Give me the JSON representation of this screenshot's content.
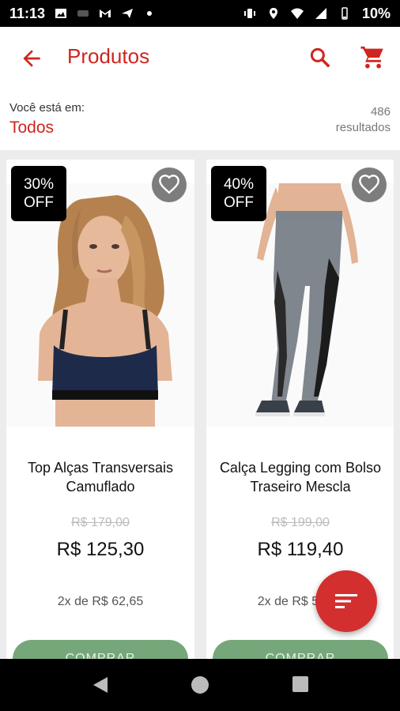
{
  "status_bar": {
    "time": "11:13",
    "battery": "10%"
  },
  "app_bar": {
    "title": "Produtos"
  },
  "location": {
    "label": "Você está em:",
    "value": "Todos",
    "results_count": "486",
    "results_label": "resultados"
  },
  "products": [
    {
      "badge_line1": "30%",
      "badge_line2": "OFF",
      "name": "Top Alças Transversais Camuflado",
      "old_price": "R$  179,00",
      "price": "R$  125,30",
      "installments": "2x de R$  62,65",
      "buy_label": "COMPRAR"
    },
    {
      "badge_line1": "40%",
      "badge_line2": "OFF",
      "name": "Calça Legging com Bolso Traseiro Mescla",
      "old_price": "R$  199,00",
      "price": "R$  119,40",
      "installments": "2x de R$  59,70",
      "buy_label": "COMPRAR"
    }
  ],
  "colors": {
    "accent": "#d0251f",
    "buy_button": "#76a77a",
    "fab": "#d32f2f"
  },
  "icons": {
    "back": "arrow-back-icon",
    "search": "search-icon",
    "cart": "cart-icon",
    "favorite": "heart-outline-icon",
    "filter": "sort-icon"
  }
}
